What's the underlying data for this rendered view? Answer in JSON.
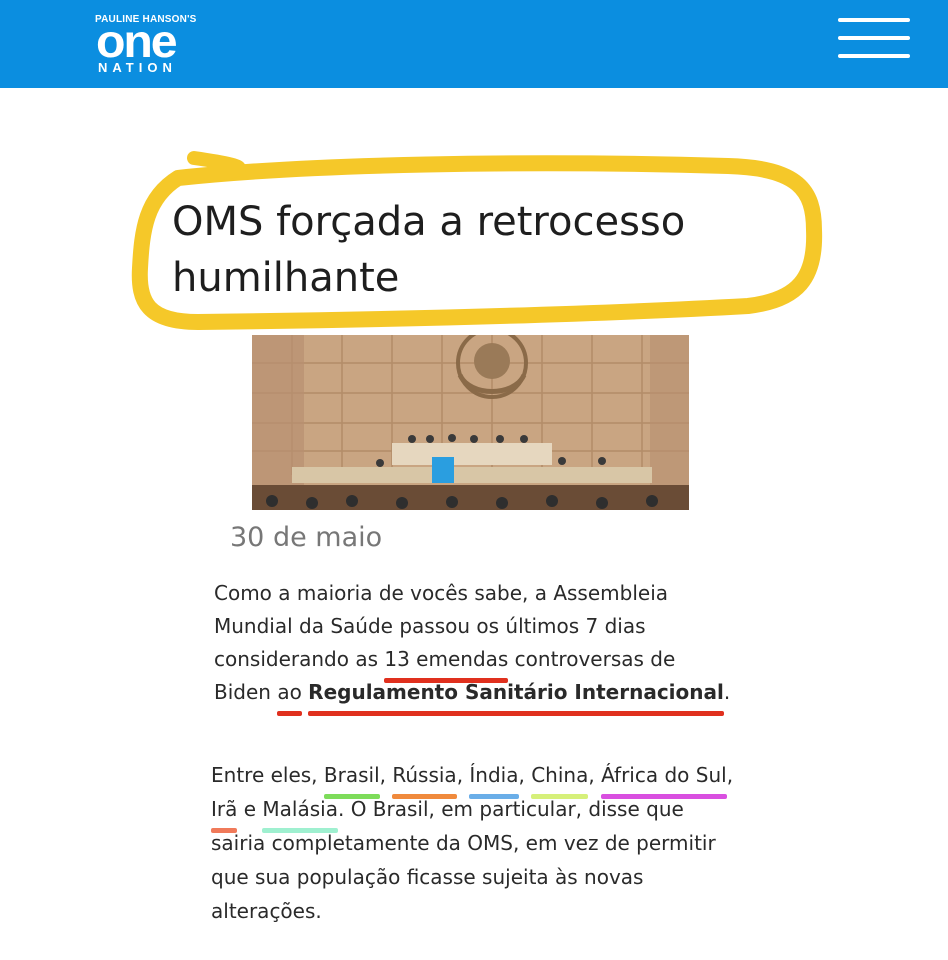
{
  "header": {
    "logo": {
      "top_text": "PAULINE HANSON'S",
      "main_text": "one",
      "bottom_text": "NATION"
    },
    "menu_icon": "hamburger-menu-icon",
    "background_color": "#0b8ee0"
  },
  "article": {
    "title_line1": "OMS forçada a retrocesso",
    "title_line2": "humilhante",
    "highlight_color": "#f5c829",
    "date": "30 de maio",
    "paragraph1": {
      "t1": "Como a maioria de vocês sabe, a Assembleia Mundial da Saúde passou os últimos 7 dias considerando as ",
      "u1": "13 emendas",
      "t2": " controversas de Biden ",
      "u2": "ao",
      "t3": " ",
      "u3": "Regulamento Sanitário Internacional",
      "t4": "."
    },
    "paragraph2": {
      "t1": "Entre eles, ",
      "c1": "Brasil",
      "s1": ", ",
      "c2": "Rússia",
      "s2": ", ",
      "c3": "Índia",
      "s3": ", ",
      "c4": "China",
      "s4": ", ",
      "c5": "África do Sul",
      "s5": ", ",
      "c6": "Irã",
      "s6": " e ",
      "c7": "Malásia",
      "t2": ". O Brasil, em particular, disse que sairia completamente da OMS, em vez de permitir que sua população ficasse sujeita às novas alterações."
    },
    "underline_colors": {
      "red": "#e0301e",
      "green": "#7ddc5a",
      "orange": "#f08a3c",
      "blue": "#6aaee8",
      "lime": "#d6f07a",
      "magenta": "#d94fe0",
      "salmon": "#f07a5a",
      "mint": "#9ff0d0"
    }
  }
}
